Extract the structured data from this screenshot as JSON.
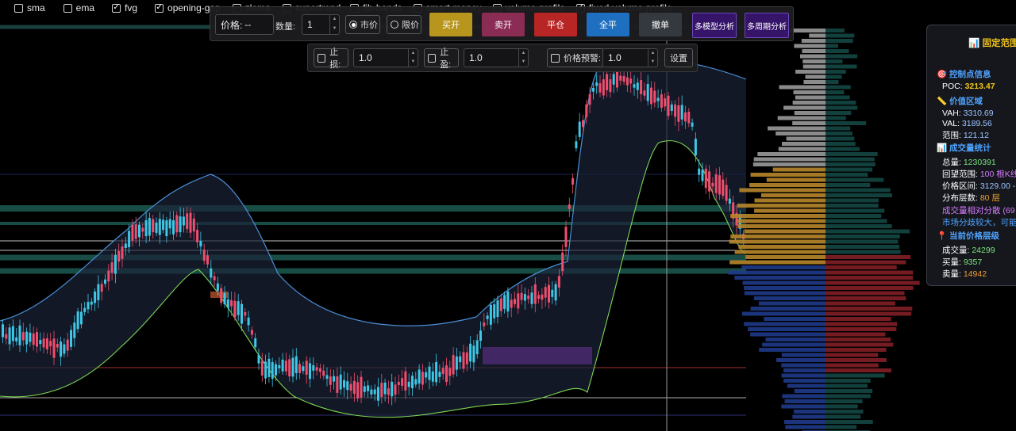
{
  "indicators": [
    {
      "label": "sma",
      "checked": false
    },
    {
      "label": "ema",
      "checked": false
    },
    {
      "label": "fvg",
      "checked": true
    },
    {
      "label": "opening-gap",
      "checked": true
    },
    {
      "label": "zlema",
      "checked": false
    },
    {
      "label": "supertrend",
      "checked": false
    },
    {
      "label": "fib-bands",
      "checked": false
    },
    {
      "label": "smart-money",
      "checked": false
    },
    {
      "label": "volume-profile",
      "checked": false
    },
    {
      "label": "fixed-volume-profile",
      "checked": true
    }
  ],
  "trade": {
    "price_label": "价格:",
    "price_value": "--",
    "qty_label": "数量:",
    "qty_value": "1",
    "market_label": "市价",
    "limit_label": "限价",
    "order_mode": "market",
    "buttons": {
      "buy": "买开",
      "sell": "卖开",
      "close": "平仓",
      "close_all": "全平",
      "cancel": "撤单",
      "multi_model": "多模型分析",
      "multi_period": "多周期分析"
    },
    "stop_loss_label": "止损:",
    "stop_loss_value": "1.0",
    "take_profit_label": "止盈:",
    "take_profit_value": "1.0",
    "price_alert_label": "价格预警:",
    "price_alert_value": "1.0",
    "set_button": "设置"
  },
  "colors": {
    "buy": "#b8961e",
    "sell": "#8b2c55",
    "close": "#b82525",
    "close_all": "#1f6fc0",
    "cancel": "#34393f",
    "analysis": "#35146a",
    "candle_up": "#ef4e6e",
    "candle_down": "#3ec7e6",
    "band_upper": "#4a8fd6",
    "band_lower": "#7dd652"
  },
  "panel": {
    "title": "固定范围",
    "poc_section": "控制点信息",
    "poc_label": "POC:",
    "poc_value": "3213.47",
    "value_area_section": "价值区域",
    "vah_label": "VAH:",
    "vah_value": "3310.69",
    "val_label": "VAL:",
    "val_value": "3189.56",
    "range_label": "范围:",
    "range_value": "121.12",
    "volume_section": "成交量统计",
    "total_label": "总量:",
    "total_value": "1230391",
    "lookback_label": "回望范围:",
    "lookback_value": "100 根K线",
    "price_range_label": "价格区间:",
    "price_range_value": "3129.00 -",
    "layers_label": "分布层数:",
    "layers_value": "80 层",
    "dispersion_text": "成交量相对分散 (69",
    "market_text": "市场分歧较大，可能",
    "current_section": "当前价格层级",
    "vol_label": "成交量:",
    "vol_value": "24299",
    "buy_label": "买量:",
    "buy_value": "9357",
    "sell_label": "卖量:",
    "sell_value": "14942"
  }
}
